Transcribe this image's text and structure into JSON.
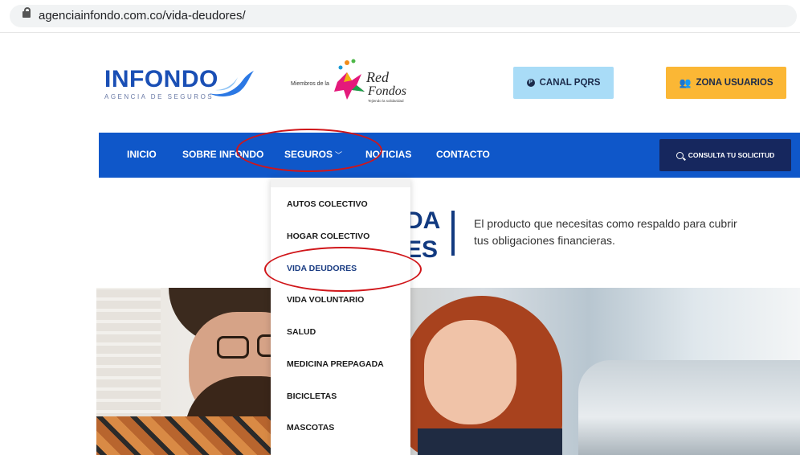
{
  "browser": {
    "url": "agenciainfondo.com.co/vida-deudores/"
  },
  "header": {
    "logo_text": "INFONDO",
    "logo_subtitle": "AGENCIA DE SEGUROS",
    "partner_label": "Miembros de la",
    "partner_logo_line1": "Red",
    "partner_logo_line2": "Fondos",
    "partner_logo_tagline": "Tejiendo la solidaridad",
    "pqrs_button": "CANAL PQRS",
    "zona_button": "ZONA USUARIOS"
  },
  "nav": {
    "items": [
      {
        "label": "INICIO"
      },
      {
        "label": "SOBRE INFONDO"
      },
      {
        "label": "SEGUROS"
      },
      {
        "label": "NOTICIAS"
      },
      {
        "label": "CONTACTO"
      }
    ],
    "consulta_button": "CONSULTA TU SOLICITUD"
  },
  "hero": {
    "title_line1_fragment": "DA",
    "title_line2_fragment": "ES",
    "description": "El producto que necesitas como respaldo  para cubrir tus obligaciones financieras."
  },
  "dropdown": {
    "items": [
      {
        "label": "AUTOS COLECTIVO"
      },
      {
        "label": "HOGAR COLECTIVO"
      },
      {
        "label": "VIDA DEUDORES",
        "active": true
      },
      {
        "label": "VIDA VOLUNTARIO"
      },
      {
        "label": "SALUD"
      },
      {
        "label": "MEDICINA PREPAGADA"
      },
      {
        "label": "BICICLETAS"
      },
      {
        "label": "MASCOTAS"
      }
    ]
  },
  "colors": {
    "nav_blue": "#0f57c9",
    "dark_navy": "#16275e",
    "pqrs_bg": "#a9dcf7",
    "zona_bg": "#fbb735",
    "annotation_red": "#d0161a"
  }
}
